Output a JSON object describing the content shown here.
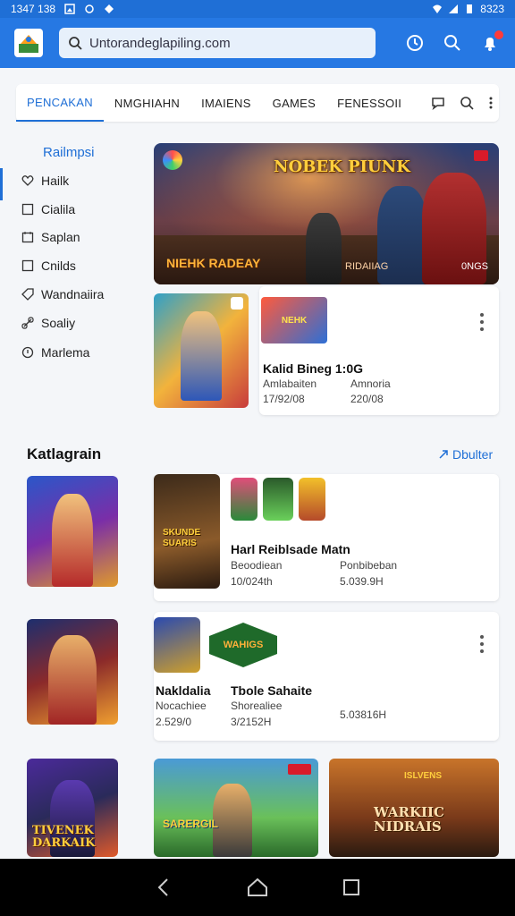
{
  "status_bar": {
    "time": "1347 138",
    "battery_text": "8323"
  },
  "app": {
    "search_value": "Untorandeglapiling.com"
  },
  "tabs": [
    "PENCAKAN",
    "NMGHIAHN",
    "IMAIENS",
    "GAMES",
    "FENESSOII"
  ],
  "sidebar": {
    "title": "Railmpsi",
    "items": [
      {
        "label": "Hailk",
        "icon": "heart-icon"
      },
      {
        "label": "Cialila",
        "icon": "checkbox-icon"
      },
      {
        "label": "Saplan",
        "icon": "calendar-icon"
      },
      {
        "label": "Cnilds",
        "icon": "checkbox-icon"
      },
      {
        "label": "Wandnaiira",
        "icon": "tag-icon"
      },
      {
        "label": "Soaliy",
        "icon": "link-icon"
      },
      {
        "label": "Marlema",
        "icon": "info-icon"
      }
    ]
  },
  "featured": {
    "title": "NOBEK PIUNK",
    "subtitle": "NIEHK RADEAY",
    "tag": "RIDAIIAG",
    "count": "0NGS"
  },
  "card1": {
    "title": "Kalid Bineg 1:0G",
    "col1_label": "Amlabaiten",
    "col1_value": "17/92/08",
    "col2_label": "Amnoria",
    "col2_value": "220/08",
    "thumb_caption": "NEHK"
  },
  "section": {
    "title": "Katlagrain",
    "see_more": "Dbulter"
  },
  "card2": {
    "title": "Harl Reiblsade Matn",
    "col1_label": "Beoodiean",
    "col1_value": "10/024th",
    "col2_label": "Ponbibeban",
    "col2_value": "5.039.9H",
    "logo_text": "SKUNDE SUARIS"
  },
  "card3": {
    "title_left": "Nakldalia",
    "title_right": "Tbole Sahaite",
    "col1_label": "Nocachiee",
    "col1_value": "2.529/0",
    "col2_label": "Shorealiee",
    "col2_value": "3/2152H",
    "col3_value": "5.03816H",
    "logo_text": "WAHIGS"
  },
  "bottom_row": {
    "left_text": "TIVENEK DARKAIK",
    "middle_text": "SARERGIL",
    "right_text": "WARKIIC NIDRAIS",
    "promo_text": "ISLVENS"
  },
  "colors": {
    "primary": "#2678e3",
    "accent": "#1f6fd6",
    "badge": "#ff3b3b"
  }
}
